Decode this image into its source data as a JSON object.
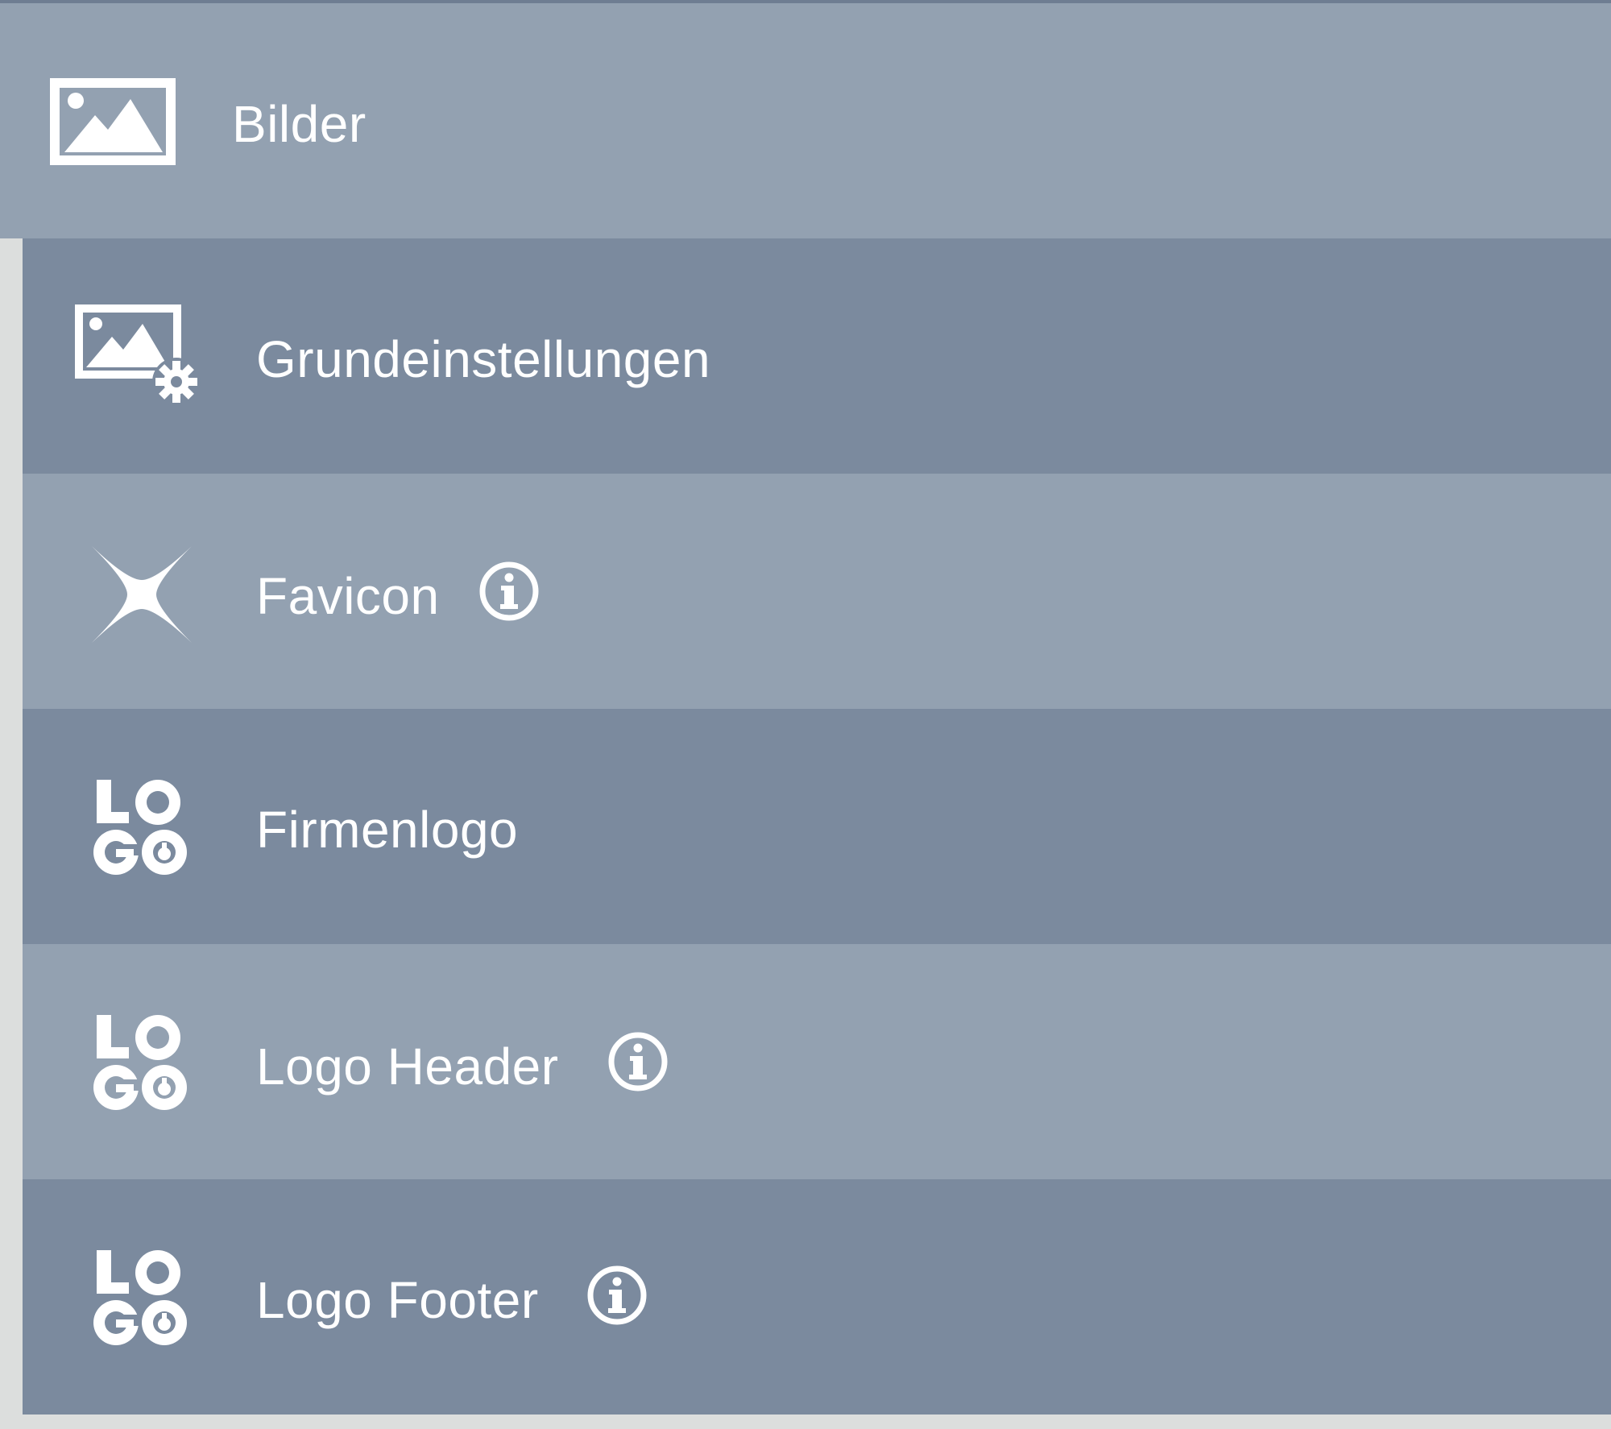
{
  "section": {
    "label": "Bilder",
    "icon": "image-icon"
  },
  "items": [
    {
      "label": "Grundeinstellungen",
      "icon": "image-settings-icon",
      "has_info": false
    },
    {
      "label": "Favicon",
      "icon": "favicon-star-icon",
      "has_info": true
    },
    {
      "label": "Firmenlogo",
      "icon": "logo-icon",
      "has_info": false
    },
    {
      "label": "Logo Header",
      "icon": "logo-icon",
      "has_info": true
    },
    {
      "label": "Logo Footer",
      "icon": "logo-icon",
      "has_info": true
    }
  ],
  "colors": {
    "row_light": "#93a1b1",
    "row_dark": "#7b8a9e",
    "background": "#dcdedd",
    "text": "#ffffff"
  }
}
